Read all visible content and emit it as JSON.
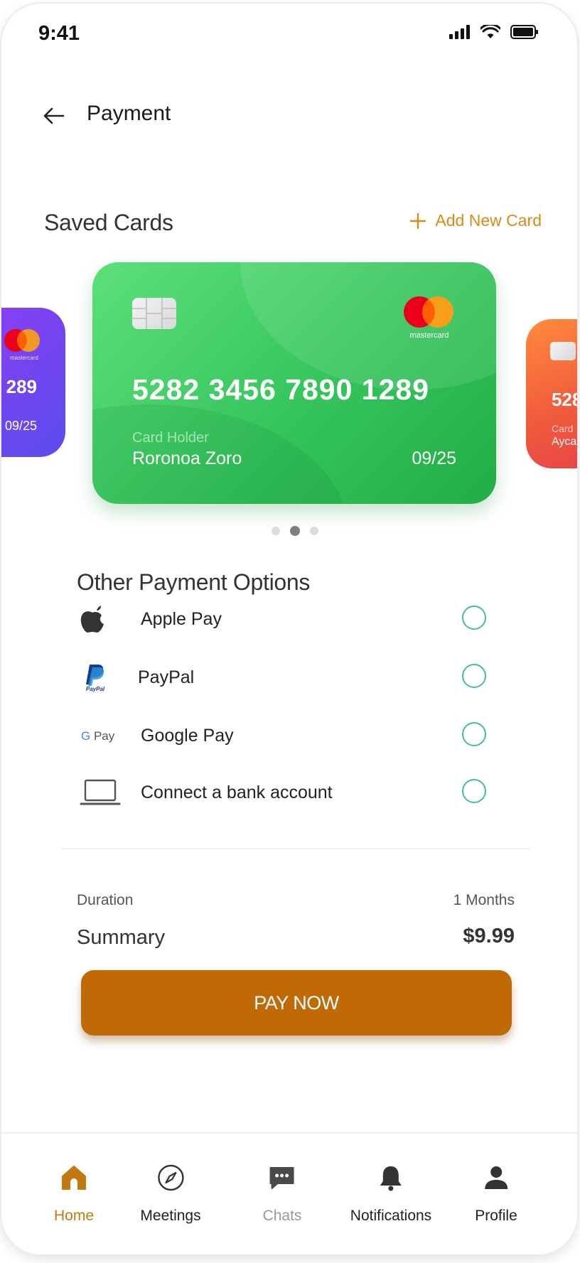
{
  "status": {
    "time": "9:41"
  },
  "header": {
    "title": "Payment"
  },
  "saved_cards": {
    "title": "Saved Cards",
    "add_label": "Add New Card",
    "cards": [
      {
        "number": "289",
        "expiry": "09/25",
        "brand": "mastercard"
      },
      {
        "number": "5282 3456 7890 1289",
        "holder_label": "Card Holder",
        "holder_name": "Roronoa Zoro",
        "expiry": "09/25",
        "brand": "mastercard"
      },
      {
        "number": "528",
        "holder_label": "Card",
        "holder_name": "Ayca"
      }
    ]
  },
  "other_payment": {
    "title": "Other Payment Options",
    "options": [
      {
        "label": "Apple Pay",
        "icon": "apple-icon"
      },
      {
        "label": "PayPal",
        "icon": "paypal-icon"
      },
      {
        "label": "Google Pay",
        "icon": "google-pay-icon"
      },
      {
        "label": "Connect a bank account",
        "icon": "laptop-icon"
      }
    ]
  },
  "summary": {
    "duration_label": "Duration",
    "duration_value": "1 Months",
    "summary_label": "Summary",
    "summary_value": "$9.99"
  },
  "pay_button": {
    "label": "PAY NOW"
  },
  "nav": {
    "items": [
      {
        "label": "Home",
        "icon": "home-icon"
      },
      {
        "label": "Meetings",
        "icon": "compass-icon"
      },
      {
        "label": "Chats",
        "icon": "chat-icon"
      },
      {
        "label": "Notifications",
        "icon": "bell-icon"
      },
      {
        "label": "Profile",
        "icon": "person-icon"
      }
    ]
  },
  "colors": {
    "accent": "#c06a06",
    "link": "#d98a16",
    "card_green": "#35c45c",
    "radio": "#46bf8f"
  }
}
